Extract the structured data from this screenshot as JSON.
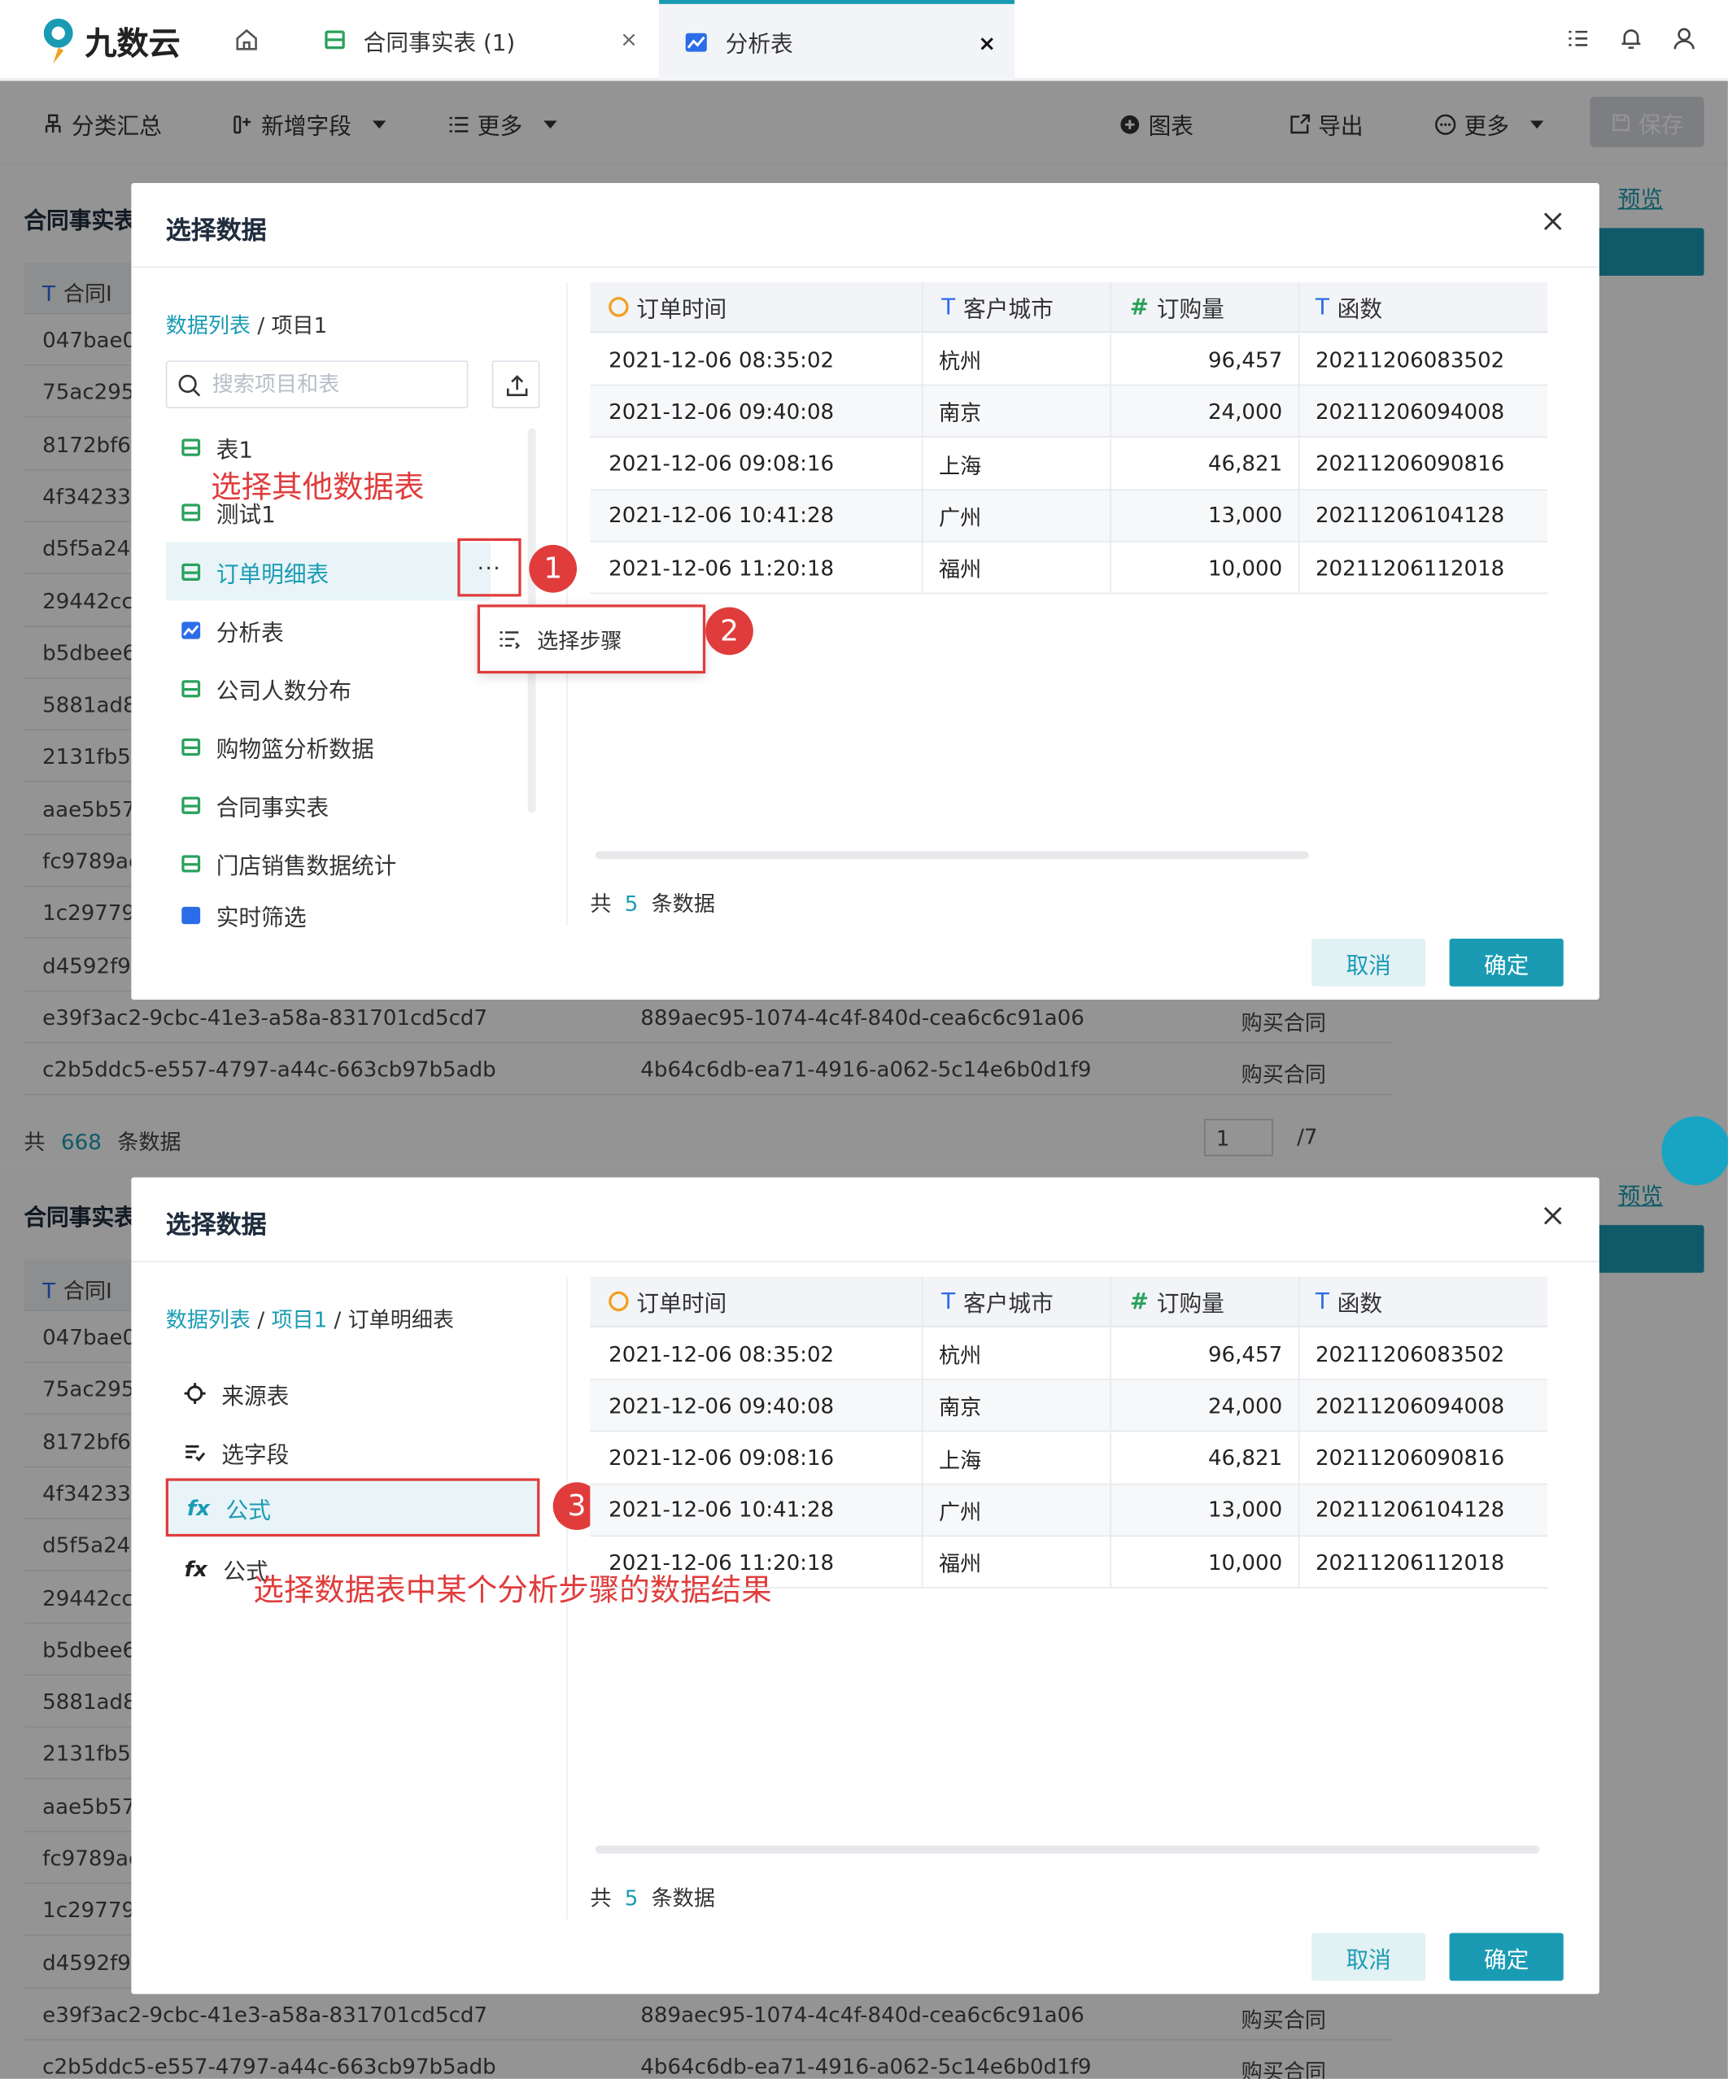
{
  "app": {
    "logo_text": "九数云"
  },
  "tabs": [
    {
      "label": "合同事实表 (1)",
      "close": "×"
    },
    {
      "label": "分析表",
      "close": "×"
    }
  ],
  "toolbar": {
    "summary": "分类汇总",
    "add_field": "新增字段",
    "more_left": "更多",
    "chart": "图表",
    "export": "导出",
    "more_right": "更多",
    "save": "保存"
  },
  "background": {
    "title": "合同事实表",
    "preview": "预览",
    "col_header": "合同I",
    "ids": [
      "047bae0",
      "75ac295",
      "8172bf6f",
      "4f34233f",
      "d5f5a243",
      "29442ccl",
      "b5dbee6",
      "5881ad8",
      "2131fb59",
      "aae5b57",
      "fc9789ac",
      "1c29779",
      "d4592f9c"
    ],
    "rows": [
      {
        "a": "e39f3ac2-9cbc-41e3-a58a-831701cd5cd7",
        "b": "889aec95-1074-4c4f-840d-cea6c6c91a06",
        "c": "购买合同"
      },
      {
        "a": "c2b5ddc5-e557-4797-a44c-663cb97b5adb",
        "b": "4b64c6db-ea71-4916-a062-5c14e6b0d1f9",
        "c": "购买合同"
      }
    ],
    "pager": {
      "prefix": "共",
      "count": "668",
      "suffix": "条数据",
      "page": "1",
      "total": "/7"
    }
  },
  "modal": {
    "title": "选择数据",
    "crumb_root": "数据列表",
    "crumb_sep": " / ",
    "crumb_project": "项目1",
    "crumb_table": "订单明细表",
    "search_placeholder": "搜索项目和表",
    "list": [
      "表1",
      "测试1",
      "订单明细表",
      "分析表",
      "公司人数分布",
      "购物篮分析数据",
      "合同事实表",
      "门店销售数据统计",
      "实时筛选"
    ],
    "dots": "···",
    "popup_item": "选择步骤",
    "steps": [
      "来源表",
      "选字段",
      "公式",
      "公式"
    ],
    "table": {
      "headers": [
        "订单时间",
        "客户城市",
        "订购量",
        "函数"
      ],
      "rows": [
        [
          "2021-12-06 08:35:02",
          "杭州",
          "96,457",
          "20211206083502"
        ],
        [
          "2021-12-06 09:40:08",
          "南京",
          "24,000",
          "20211206094008"
        ],
        [
          "2021-12-06 09:08:16",
          "上海",
          "46,821",
          "20211206090816"
        ],
        [
          "2021-12-06 10:41:28",
          "广州",
          "13,000",
          "20211206104128"
        ],
        [
          "2021-12-06 11:20:18",
          "福州",
          "10,000",
          "20211206112018"
        ]
      ]
    },
    "count_prefix": "共",
    "count": "5",
    "count_suffix": "条数据",
    "cancel": "取消",
    "ok": "确定"
  },
  "annotations": {
    "a1": "选择其他数据表",
    "a2": "选择数据表中某个分析步骤的数据结果",
    "b1": "1",
    "b2": "2",
    "b3": "3"
  }
}
